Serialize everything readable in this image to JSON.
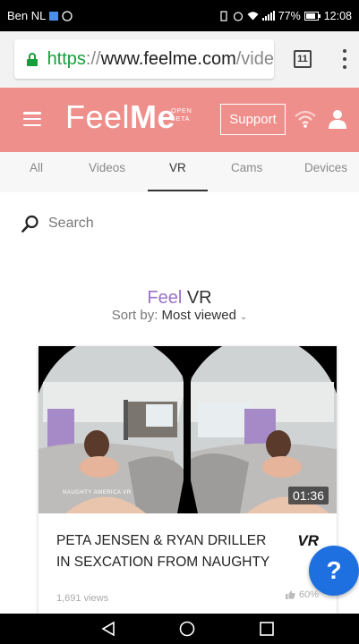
{
  "status_bar": {
    "carrier": "Ben NL",
    "battery": "77%",
    "time": "12:08"
  },
  "browser": {
    "url_scheme": "https",
    "url_sep": "://",
    "url_host": "www.feelme.com",
    "url_path": "/vide",
    "tabs_count": "11"
  },
  "site": {
    "logo_feel": "Feel",
    "logo_me": "Me",
    "logo_tag_1": "OPEN",
    "logo_tag_2": "BETA",
    "support_label": "Support",
    "header_color": "#ef8f8c"
  },
  "nav": {
    "tabs": [
      {
        "label": "All"
      },
      {
        "label": "Videos"
      },
      {
        "label": "VR"
      },
      {
        "label": "Cams"
      },
      {
        "label": "Devices"
      }
    ],
    "active": "VR"
  },
  "search": {
    "placeholder": "Search"
  },
  "section": {
    "title_feel": "Feel",
    "title_vr": "VR",
    "sort_label": "Sort by:",
    "sort_value": "Most viewed"
  },
  "card": {
    "title": "PETA JENSEN & RYAN DRILLER IN SEXCATION FROM NAUGHTY",
    "duration": "01:36",
    "badge": "VR",
    "watermark": "NAUGHTY AMERICA VR",
    "views": "1,691 views",
    "rating": "60%"
  },
  "help": {
    "label": "?"
  }
}
